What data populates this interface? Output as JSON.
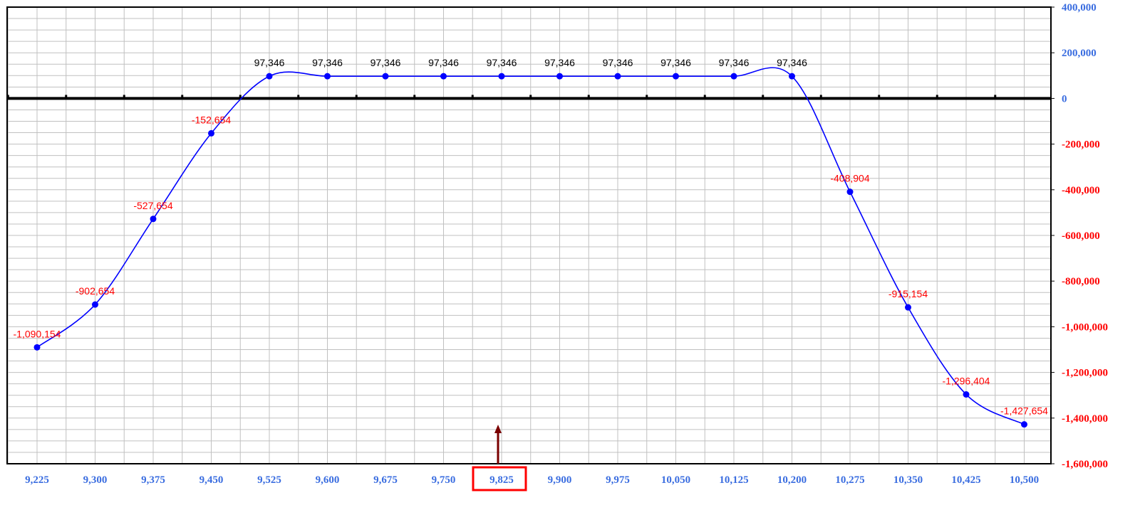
{
  "chart_data": {
    "type": "line",
    "title": "",
    "xlabel": "",
    "ylabel": "",
    "x": [
      9225,
      9300,
      9375,
      9450,
      9525,
      9600,
      9675,
      9750,
      9825,
      9900,
      9975,
      10050,
      10125,
      10200,
      10275,
      10350,
      10425,
      10500
    ],
    "x_labels": [
      "9,225",
      "9,300",
      "9,375",
      "9,450",
      "9,525",
      "9,600",
      "9,675",
      "9,750",
      "9,825",
      "9,900",
      "9,975",
      "10,050",
      "10,125",
      "10,200",
      "10,275",
      "10,350",
      "10,425",
      "10,500"
    ],
    "series": [
      {
        "values": [
          -1090154,
          -902654,
          -527654,
          -152654,
          97346,
          97346,
          97346,
          97346,
          97346,
          97346,
          97346,
          97346,
          97346,
          97346,
          -408904,
          -915154,
          -1296404,
          -1427654
        ],
        "data_labels": [
          "-1,090,154",
          "-902,654",
          "-527,654",
          "-152,654",
          "97,346",
          "97,346",
          "97,346",
          "97,346",
          "97,346",
          "97,346",
          "97,346",
          "97,346",
          "97,346",
          "97,346",
          "-408,904",
          "-915,154",
          "-1,296,404",
          "-1,427,654"
        ],
        "color": "#0000ff"
      }
    ],
    "ylim": [
      -1600000,
      400000
    ],
    "y_ticks": [
      400000,
      200000,
      0,
      -200000,
      -400000,
      -600000,
      -800000,
      -1000000,
      -1200000,
      -1400000,
      -1600000
    ],
    "y_tick_labels": [
      "400,000",
      "200,000",
      "0",
      "-200,000",
      "-400,000",
      "-600,000",
      "-800,000",
      "-1,000,000",
      "-1,200,000",
      "-1,400,000",
      "-1,600,000"
    ],
    "y_axis_side": "right",
    "grid": true,
    "legend": "none",
    "highlighted_x_label": "9,825",
    "current_price_marker": 9825,
    "colors": {
      "line": "#0000ff",
      "positive_label": "#000000",
      "negative_label": "#ff0000",
      "x_tick": "#3a6de0",
      "y_tick_positive": "#3a6de0",
      "y_tick_negative": "#ff0000",
      "highlight_box": "#ff0000",
      "arrow": "#7a0000",
      "grid": "#c0c0c0",
      "zero_line": "#000000"
    }
  }
}
